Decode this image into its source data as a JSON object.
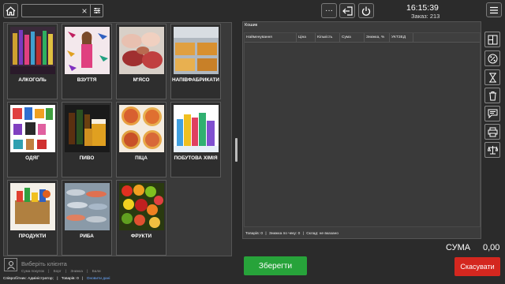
{
  "search": {
    "value": "",
    "placeholder": ""
  },
  "categories": [
    {
      "label": "АЛКОГОЛЬ"
    },
    {
      "label": "ВЗУТТЯ"
    },
    {
      "label": "М'ЯСО"
    },
    {
      "label": "НАПІВФАБРИКАТИ"
    },
    {
      "label": "ОДЯГ"
    },
    {
      "label": "ПИВО"
    },
    {
      "label": "ПІЦА"
    },
    {
      "label": "ПОБУТОВА ХІМІЯ"
    },
    {
      "label": "ПРОДУКТИ"
    },
    {
      "label": "РИБА"
    },
    {
      "label": "ФРУКТИ"
    }
  ],
  "header": {
    "more_label": "···",
    "time": "16:15:39",
    "order": "Заказ: 213"
  },
  "cart": {
    "title": "Кошик",
    "columns": [
      "Найменування",
      "Ціна",
      "Кількість",
      "Сума",
      "Знижка, %",
      "УКТЗЕД"
    ],
    "footer": {
      "goods_label": "Товарів:",
      "goods_value": "0",
      "discount_label": "Знижка по чеку:",
      "discount_value": "0",
      "warehouse_label": "Склад:",
      "warehouse_value": "не вказано"
    }
  },
  "total": {
    "label": "СУМА",
    "value": "0,00"
  },
  "actions": {
    "save": "Зберегти",
    "cancel": "Скасувати"
  },
  "client": {
    "select_label": "Виберіть клієнта",
    "links": [
      "Сума покупок",
      "Борг",
      "Знижка",
      "Бали"
    ]
  },
  "status": {
    "employee_label": "Співробітник:",
    "employee_value": "Адміністратор;",
    "goods_label": "Товарів:",
    "goods_value": "0",
    "refresh_label": "Оновити дані"
  },
  "colors": {
    "save": "#27a33a",
    "cancel": "#d4271f",
    "background": "#2b2b2b"
  }
}
